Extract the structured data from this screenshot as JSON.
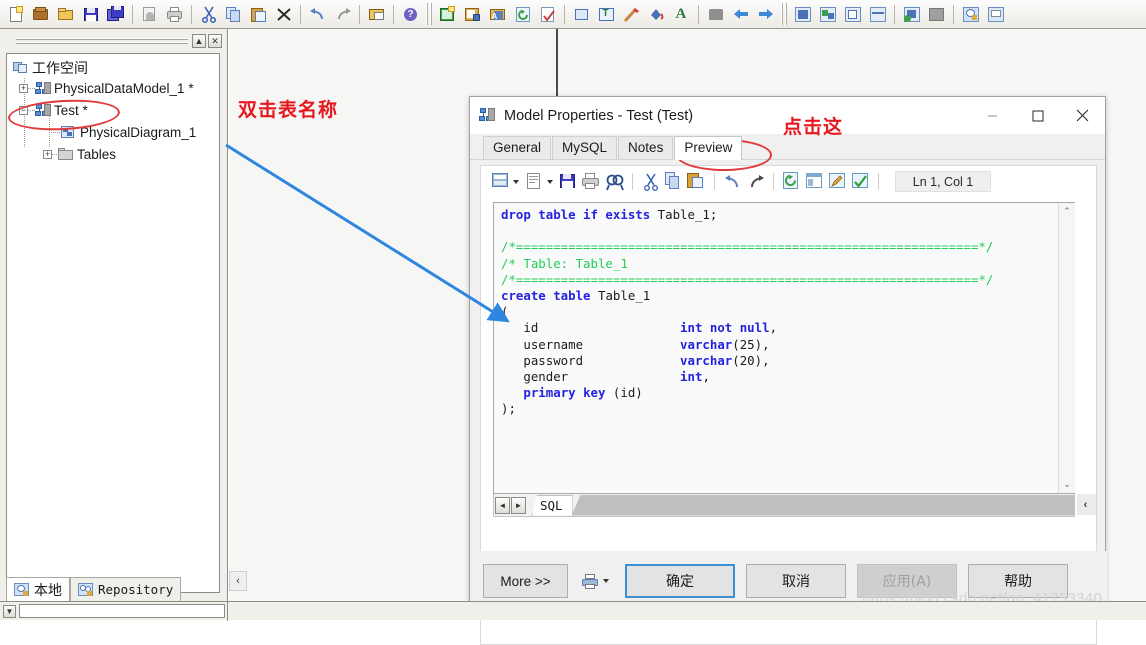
{
  "toolbar": {
    "groups": [
      {
        "name": "file",
        "buttons": [
          {
            "icon": "new-document-icon",
            "label": "New"
          },
          {
            "icon": "new-package-icon",
            "label": "New Package"
          },
          {
            "icon": "open-folder-icon",
            "label": "Open"
          },
          {
            "icon": "save-icon",
            "label": "Save"
          },
          {
            "icon": "save-all-icon",
            "label": "Save All"
          }
        ]
      },
      {
        "name": "print",
        "buttons": [
          {
            "icon": "print-preview-icon",
            "label": "Print Preview"
          },
          {
            "icon": "print-icon",
            "label": "Print"
          }
        ]
      },
      {
        "name": "clipboard",
        "buttons": [
          {
            "icon": "cut-icon",
            "label": "Cut"
          },
          {
            "icon": "copy-icon",
            "label": "Copy"
          },
          {
            "icon": "paste-icon",
            "label": "Paste"
          },
          {
            "icon": "delete-icon",
            "label": "Delete"
          }
        ]
      },
      {
        "name": "history",
        "buttons": [
          {
            "icon": "undo-icon",
            "label": "Undo"
          },
          {
            "icon": "redo-icon",
            "label": "Redo"
          }
        ]
      },
      {
        "name": "properties",
        "buttons": [
          {
            "icon": "properties-icon",
            "label": "Properties"
          }
        ]
      },
      {
        "name": "help",
        "buttons": [
          {
            "icon": "help-icon",
            "label": "Help"
          }
        ]
      },
      {
        "name": "model",
        "buttons": [
          {
            "icon": "new-model-icon",
            "label": "New Model"
          },
          {
            "icon": "generate-database-icon",
            "label": "Generate Database"
          },
          {
            "icon": "reverse-engineer-icon",
            "label": "Reverse Engineer"
          },
          {
            "icon": "refresh-icon",
            "label": "Refresh"
          },
          {
            "icon": "check-model-icon",
            "label": "Check Model"
          }
        ]
      },
      {
        "name": "format",
        "buttons": [
          {
            "icon": "shape-icon",
            "label": "Shape"
          },
          {
            "icon": "text-frame-icon",
            "label": "Text Frame"
          },
          {
            "icon": "line-style-icon",
            "label": "Line Style"
          },
          {
            "icon": "fill-color-icon",
            "label": "Fill Color"
          },
          {
            "icon": "font-color-icon",
            "label": "Font Color"
          }
        ]
      },
      {
        "name": "navigate",
        "buttons": [
          {
            "icon": "hand-tool-icon",
            "label": "Pan"
          },
          {
            "icon": "back-arrow-icon",
            "label": "Back"
          },
          {
            "icon": "forward-arrow-icon",
            "label": "Forward"
          }
        ]
      },
      {
        "name": "diagram",
        "buttons": [
          {
            "icon": "entity-icon",
            "label": "Entity"
          },
          {
            "icon": "relationship-icon",
            "label": "Relationship"
          },
          {
            "icon": "view-icon",
            "label": "View"
          },
          {
            "icon": "reference-icon",
            "label": "Reference"
          }
        ]
      },
      {
        "name": "tools",
        "buttons": [
          {
            "icon": "link-entity-icon",
            "label": "Link Entity"
          },
          {
            "icon": "note-tool-icon",
            "label": "Note"
          }
        ]
      },
      {
        "name": "panels",
        "buttons": [
          {
            "icon": "browser-panel-icon",
            "label": "Browser"
          },
          {
            "icon": "output-panel-icon",
            "label": "Output"
          }
        ]
      }
    ]
  },
  "browser": {
    "caption_buttons": [
      {
        "name": "minimize-panel-button",
        "glyph": "▲"
      },
      {
        "name": "close-panel-button",
        "glyph": "✕"
      }
    ],
    "tree": [
      {
        "label": "工作空间",
        "icon": "workspace-icon",
        "level": 0,
        "expander": ""
      },
      {
        "label": "PhysicalDataModel_1 *",
        "icon": "model-icon",
        "level": 1,
        "expander": "+"
      },
      {
        "label": "Test *",
        "icon": "model-icon",
        "level": 1,
        "expander": "−"
      },
      {
        "label": "PhysicalDiagram_1",
        "icon": "diagram-icon",
        "level": 2,
        "expander": ""
      },
      {
        "label": "Tables",
        "icon": "folder-icon",
        "level": 2,
        "expander": "+"
      }
    ],
    "tabs": [
      {
        "label": "本地",
        "icon": "local-icon",
        "active": true
      },
      {
        "label": "Repository",
        "icon": "repository-icon",
        "active": false
      }
    ]
  },
  "annotations": {
    "left_note": "双击表名称",
    "dialog_note": "点击这",
    "accent_red": "#e8161d",
    "ellipse_red": "#e03a3a",
    "arrow_blue": "#2e86e0",
    "highlight_yellow": "#f8f40a"
  },
  "canvas": {
    "scroll_left_glyph": "‹"
  },
  "dialog": {
    "title": "Model Properties - Test (Test)",
    "title_icon": "model-properties-icon",
    "window_buttons": [
      {
        "name": "minimize-button",
        "glyph": "—"
      },
      {
        "name": "maximize-button",
        "glyph": "▭"
      },
      {
        "name": "close-button",
        "glyph": "✕"
      }
    ],
    "tabs": [
      {
        "label": "General",
        "active": false
      },
      {
        "label": "MySQL",
        "active": false
      },
      {
        "label": "Notes",
        "active": false
      },
      {
        "label": "Preview",
        "active": true
      }
    ],
    "editor_toolbar": {
      "buttons": [
        {
          "icon": "open-script-icon",
          "dropdown": true
        },
        {
          "icon": "new-script-icon",
          "dropdown": true
        },
        {
          "icon": "save-script-icon",
          "dropdown": false
        },
        {
          "icon": "print-script-icon",
          "dropdown": false
        },
        {
          "icon": "find-icon",
          "dropdown": false
        },
        {
          "icon": "cut-icon",
          "dropdown": false
        },
        {
          "icon": "copy-icon",
          "dropdown": false
        },
        {
          "icon": "paste-icon",
          "dropdown": false
        },
        {
          "icon": "undo-icon",
          "dropdown": false
        },
        {
          "icon": "redo-icon",
          "dropdown": false
        },
        {
          "icon": "refresh-script-icon",
          "dropdown": false
        },
        {
          "icon": "properties-script-icon",
          "dropdown": false
        },
        {
          "icon": "edit-script-icon",
          "dropdown": false
        },
        {
          "icon": "validate-script-icon",
          "dropdown": false
        }
      ],
      "status": "Ln 1, Col 1"
    },
    "code_lines": [
      [
        {
          "t": "drop table if exists ",
          "c": "kw"
        },
        {
          "t": "Table_1;",
          "c": "pl"
        }
      ],
      [],
      [
        {
          "t": "/*==============================================================*/",
          "c": "cm"
        }
      ],
      [
        {
          "t": "/* Table: Table_1",
          "c": "cm"
        }
      ],
      [
        {
          "t": "/*==============================================================*/",
          "c": "cm"
        }
      ],
      [
        {
          "t": "create table ",
          "c": "kw"
        },
        {
          "t": "Table_1",
          "c": "pl"
        }
      ],
      [
        {
          "t": "(",
          "c": "pl"
        }
      ],
      [
        {
          "t": "   id                   ",
          "c": "pl"
        },
        {
          "t": "int not null",
          "c": "kw"
        },
        {
          "t": ",",
          "c": "pl"
        }
      ],
      [
        {
          "t": "   username             ",
          "c": "pl"
        },
        {
          "t": "varchar",
          "c": "kw"
        },
        {
          "t": "(25),",
          "c": "pl"
        }
      ],
      [
        {
          "t": "   password             ",
          "c": "pl"
        },
        {
          "t": "varchar",
          "c": "kw"
        },
        {
          "t": "(20),",
          "c": "pl"
        }
      ],
      [
        {
          "t": "   gender               ",
          "c": "pl"
        },
        {
          "t": "int",
          "c": "kw"
        },
        {
          "t": ",",
          "c": "pl"
        }
      ],
      [
        {
          "t": "   ",
          "c": "pl"
        },
        {
          "t": "primary key ",
          "c": "kw"
        },
        {
          "t": "(id)",
          "c": "pl"
        }
      ],
      [
        {
          "t": ");",
          "c": "pl"
        }
      ]
    ],
    "sql_tab": "SQL",
    "nav_buttons": [
      {
        "name": "tab-scroll-left-button",
        "glyph": "◄"
      },
      {
        "name": "tab-scroll-right-button",
        "glyph": "►"
      }
    ],
    "hscroll": {
      "left_glyph": "‹",
      "right_glyph": "›"
    },
    "vscroll": {
      "up_glyph": "⌃",
      "down_glyph": "⌄"
    },
    "footer_buttons": [
      {
        "label": "More >>",
        "name": "more-button",
        "style": "more",
        "enabled": true
      },
      {
        "label": "确定",
        "name": "ok-button",
        "style": "primary",
        "enabled": true
      },
      {
        "label": "取消",
        "name": "cancel-button",
        "style": "w100",
        "enabled": true
      },
      {
        "label": "应用(A)",
        "name": "apply-button",
        "style": "w100 disabled",
        "enabled": false
      },
      {
        "label": "帮助",
        "name": "help-button",
        "style": "w100",
        "enabled": true
      }
    ],
    "footer_print_icon": "print-options-icon"
  },
  "watermark": "https://blog.csdn.net/qq_41753340"
}
